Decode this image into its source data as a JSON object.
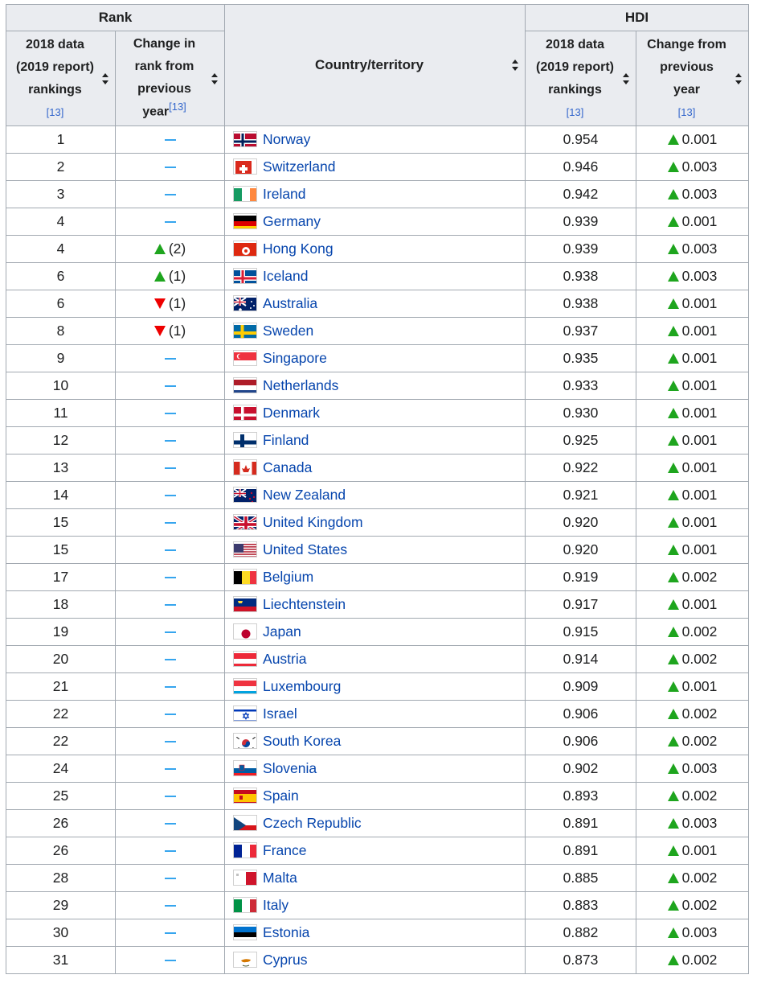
{
  "header": {
    "rank_group": "Rank",
    "hdi_group": "HDI",
    "country": "Country/territory",
    "rank_2018_line1": "2018 data",
    "rank_2018_line2": "(2019 report)",
    "rank_2018_line3": "rankings",
    "rank_ref": "[13]",
    "change_rank_line1": "Change in",
    "change_rank_line2": "rank from",
    "change_rank_line3": "previous",
    "change_rank_line4": "year",
    "change_rank_ref": "[13]",
    "hdi_2018_line1": "2018 data",
    "hdi_2018_line2": "(2019 report)",
    "hdi_2018_line3": "rankings",
    "hdi_2018_ref": "[13]",
    "hdi_change_line1": "Change from",
    "hdi_change_line2": "previous",
    "hdi_change_line3": "year",
    "hdi_change_ref": "[13]"
  },
  "colors": {
    "up": "#1ea51e",
    "down": "#ee0000",
    "dash": "#36a5ee",
    "link": "#0645ad",
    "header_bg": "#eaecf0",
    "border": "#a2a9b1"
  },
  "rows": [
    {
      "rank": "1",
      "change": {
        "dir": "none"
      },
      "country": "Norway",
      "flag": "norway",
      "hdi": "0.954",
      "hdi_change": "0.001"
    },
    {
      "rank": "2",
      "change": {
        "dir": "none"
      },
      "country": "Switzerland",
      "flag": "switzerland",
      "hdi": "0.946",
      "hdi_change": "0.003"
    },
    {
      "rank": "3",
      "change": {
        "dir": "none"
      },
      "country": "Ireland",
      "flag": "ireland",
      "hdi": "0.942",
      "hdi_change": "0.003"
    },
    {
      "rank": "4",
      "change": {
        "dir": "none"
      },
      "country": "Germany",
      "flag": "germany",
      "hdi": "0.939",
      "hdi_change": "0.001"
    },
    {
      "rank": "4",
      "change": {
        "dir": "up",
        "value": "(2)"
      },
      "country": "Hong Kong",
      "flag": "hong-kong",
      "hdi": "0.939",
      "hdi_change": "0.003"
    },
    {
      "rank": "6",
      "change": {
        "dir": "up",
        "value": "(1)"
      },
      "country": "Iceland",
      "flag": "iceland",
      "hdi": "0.938",
      "hdi_change": "0.003"
    },
    {
      "rank": "6",
      "change": {
        "dir": "down",
        "value": "(1)"
      },
      "country": "Australia",
      "flag": "australia",
      "hdi": "0.938",
      "hdi_change": "0.001"
    },
    {
      "rank": "8",
      "change": {
        "dir": "down",
        "value": "(1)"
      },
      "country": "Sweden",
      "flag": "sweden",
      "hdi": "0.937",
      "hdi_change": "0.001"
    },
    {
      "rank": "9",
      "change": {
        "dir": "none"
      },
      "country": "Singapore",
      "flag": "singapore",
      "hdi": "0.935",
      "hdi_change": "0.001"
    },
    {
      "rank": "10",
      "change": {
        "dir": "none"
      },
      "country": "Netherlands",
      "flag": "netherlands",
      "hdi": "0.933",
      "hdi_change": "0.001"
    },
    {
      "rank": "11",
      "change": {
        "dir": "none"
      },
      "country": "Denmark",
      "flag": "denmark",
      "hdi": "0.930",
      "hdi_change": "0.001"
    },
    {
      "rank": "12",
      "change": {
        "dir": "none"
      },
      "country": "Finland",
      "flag": "finland",
      "hdi": "0.925",
      "hdi_change": "0.001"
    },
    {
      "rank": "13",
      "change": {
        "dir": "none"
      },
      "country": "Canada",
      "flag": "canada",
      "hdi": "0.922",
      "hdi_change": "0.001"
    },
    {
      "rank": "14",
      "change": {
        "dir": "none"
      },
      "country": "New Zealand",
      "flag": "new-zealand",
      "hdi": "0.921",
      "hdi_change": "0.001"
    },
    {
      "rank": "15",
      "change": {
        "dir": "none"
      },
      "country": "United Kingdom",
      "flag": "united-kingdom",
      "hdi": "0.920",
      "hdi_change": "0.001"
    },
    {
      "rank": "15",
      "change": {
        "dir": "none"
      },
      "country": "United States",
      "flag": "united-states",
      "hdi": "0.920",
      "hdi_change": "0.001"
    },
    {
      "rank": "17",
      "change": {
        "dir": "none"
      },
      "country": "Belgium",
      "flag": "belgium",
      "hdi": "0.919",
      "hdi_change": "0.002"
    },
    {
      "rank": "18",
      "change": {
        "dir": "none"
      },
      "country": "Liechtenstein",
      "flag": "liechtenstein",
      "hdi": "0.917",
      "hdi_change": "0.001"
    },
    {
      "rank": "19",
      "change": {
        "dir": "none"
      },
      "country": "Japan",
      "flag": "japan",
      "hdi": "0.915",
      "hdi_change": "0.002"
    },
    {
      "rank": "20",
      "change": {
        "dir": "none"
      },
      "country": "Austria",
      "flag": "austria",
      "hdi": "0.914",
      "hdi_change": "0.002"
    },
    {
      "rank": "21",
      "change": {
        "dir": "none"
      },
      "country": "Luxembourg",
      "flag": "luxembourg",
      "hdi": "0.909",
      "hdi_change": "0.001"
    },
    {
      "rank": "22",
      "change": {
        "dir": "none"
      },
      "country": "Israel",
      "flag": "israel",
      "hdi": "0.906",
      "hdi_change": "0.002"
    },
    {
      "rank": "22",
      "change": {
        "dir": "none"
      },
      "country": "South Korea",
      "flag": "south-korea",
      "hdi": "0.906",
      "hdi_change": "0.002"
    },
    {
      "rank": "24",
      "change": {
        "dir": "none"
      },
      "country": "Slovenia",
      "flag": "slovenia",
      "hdi": "0.902",
      "hdi_change": "0.003"
    },
    {
      "rank": "25",
      "change": {
        "dir": "none"
      },
      "country": "Spain",
      "flag": "spain",
      "hdi": "0.893",
      "hdi_change": "0.002"
    },
    {
      "rank": "26",
      "change": {
        "dir": "none"
      },
      "country": "Czech Republic",
      "flag": "czech-republic",
      "hdi": "0.891",
      "hdi_change": "0.003"
    },
    {
      "rank": "26",
      "change": {
        "dir": "none"
      },
      "country": "France",
      "flag": "france",
      "hdi": "0.891",
      "hdi_change": "0.001"
    },
    {
      "rank": "28",
      "change": {
        "dir": "none"
      },
      "country": "Malta",
      "flag": "malta",
      "hdi": "0.885",
      "hdi_change": "0.002"
    },
    {
      "rank": "29",
      "change": {
        "dir": "none"
      },
      "country": "Italy",
      "flag": "italy",
      "hdi": "0.883",
      "hdi_change": "0.002"
    },
    {
      "rank": "30",
      "change": {
        "dir": "none"
      },
      "country": "Estonia",
      "flag": "estonia",
      "hdi": "0.882",
      "hdi_change": "0.003"
    },
    {
      "rank": "31",
      "change": {
        "dir": "none"
      },
      "country": "Cyprus",
      "flag": "cyprus",
      "hdi": "0.873",
      "hdi_change": "0.002"
    }
  ]
}
